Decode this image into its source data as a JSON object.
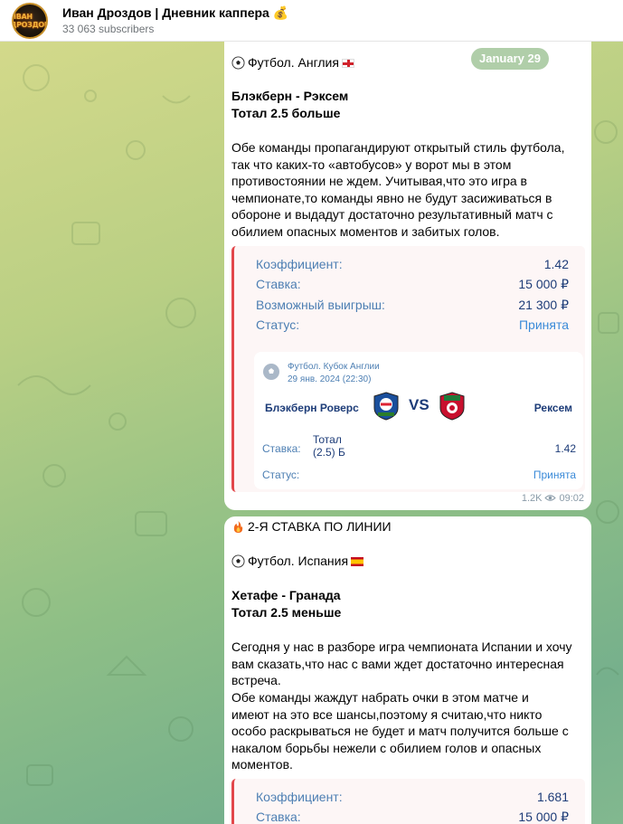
{
  "channel": {
    "title": "Иван Дроздов | Дневник каппера 💰",
    "subscribers": "33 063 subscribers",
    "avatar_text": "ИВАН ДРОЗДОВ"
  },
  "date_pill": "January 29",
  "post1": {
    "sport_line": "Футбол. Англия",
    "match": "Блэкберн - Рэксем",
    "market": "Тотал 2.5 больше",
    "body": [
      "Обе команды пропагандируют открытый стиль футбола,",
      "так что каких-то «автобусов» у ворот мы в этом",
      "противостоянии не ждем. Учитывая,что это игра в",
      "чемпионате,то команды явно не будут засиживаться в",
      "обороне и выдадут достаточно результативный матч с",
      "обилием опасных моментов и забитых голов."
    ],
    "bet": {
      "coef_label": "Коэффициент:",
      "coef_value": "1.42",
      "stake_label": "Ставка:",
      "stake_value": "15 000 ₽",
      "win_label": "Возможный выигрыш:",
      "win_value": "21 300 ₽",
      "status_label": "Статус:",
      "status_value": "Принята"
    },
    "card": {
      "league": "Футбол. Кубок Англии",
      "datetime": "29 янв. 2024 (22:30)",
      "team_a": "Блэкберн Роверс",
      "vs": "VS",
      "team_b": "Рексем",
      "stake_label": "Ставка:",
      "market_line1": "Тотал",
      "market_line2": "(2.5) Б",
      "odds": "1.42",
      "status_label": "Статус:",
      "status_value": "Принята"
    },
    "views": "1.2K",
    "time": "09:02"
  },
  "post2": {
    "header": "2-Я СТАВКА ПО ЛИНИИ",
    "sport_line": "Футбол. Испания",
    "match": "Хетафе - Гранада",
    "market": "Тотал 2.5 меньше",
    "body": [
      "Сегодня у нас в разборе игра чемпионата Испании и хочу",
      "вам сказать,что нас с вами ждет достаточно интересная",
      "встреча.",
      "Обе команды жаждут набрать очки в этом матче и",
      "имеют на это все шансы,поэтому я считаю,что никто",
      "особо раскрываться не будет и матч получится больше с",
      "накалом борьбы нежели с обилием голов и опасных",
      "моментов."
    ],
    "bet": {
      "coef_label": "Коэффициент:",
      "coef_value": "1.681",
      "stake_label": "Ставка:",
      "stake_value": "15 000 ₽"
    }
  }
}
